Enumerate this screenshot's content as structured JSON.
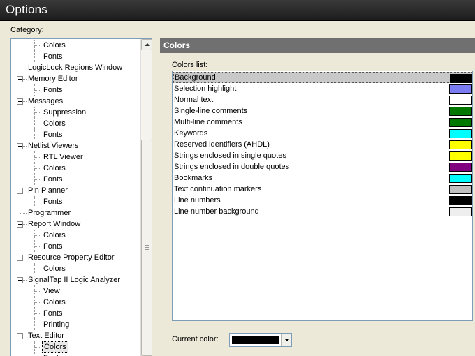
{
  "window": {
    "title": "Options"
  },
  "category": {
    "label": "Category:",
    "tree": [
      {
        "label": "Colors",
        "level": 2
      },
      {
        "label": "Fonts",
        "level": 2
      },
      {
        "label": "LogicLock Regions Window",
        "level": 1,
        "expander": false
      },
      {
        "label": "Memory Editor",
        "level": 1,
        "expander": true
      },
      {
        "label": "Fonts",
        "level": 2
      },
      {
        "label": "Messages",
        "level": 1,
        "expander": true
      },
      {
        "label": "Suppression",
        "level": 2
      },
      {
        "label": "Colors",
        "level": 2
      },
      {
        "label": "Fonts",
        "level": 2
      },
      {
        "label": "Netlist Viewers",
        "level": 1,
        "expander": true
      },
      {
        "label": "RTL Viewer",
        "level": 2
      },
      {
        "label": "Colors",
        "level": 2
      },
      {
        "label": "Fonts",
        "level": 2
      },
      {
        "label": "Pin Planner",
        "level": 1,
        "expander": true
      },
      {
        "label": "Fonts",
        "level": 2
      },
      {
        "label": "Programmer",
        "level": 1,
        "expander": false
      },
      {
        "label": "Report Window",
        "level": 1,
        "expander": true
      },
      {
        "label": "Colors",
        "level": 2
      },
      {
        "label": "Fonts",
        "level": 2
      },
      {
        "label": "Resource Property Editor",
        "level": 1,
        "expander": true
      },
      {
        "label": "Colors",
        "level": 2
      },
      {
        "label": "SignalTap II Logic Analyzer",
        "level": 1,
        "expander": true
      },
      {
        "label": "View",
        "level": 2
      },
      {
        "label": "Colors",
        "level": 2
      },
      {
        "label": "Fonts",
        "level": 2
      },
      {
        "label": "Printing",
        "level": 2
      },
      {
        "label": "Text Editor",
        "level": 1,
        "expander": true
      },
      {
        "label": "Colors",
        "level": 2,
        "selected": true
      },
      {
        "label": "Fonts",
        "level": 2
      }
    ]
  },
  "panel": {
    "title": "Colors",
    "colors_list_label": "Colors list:",
    "colors_list": [
      {
        "name": "Background",
        "color": "#000000",
        "selected": true
      },
      {
        "name": "Selection highlight",
        "color": "#7b7bf2"
      },
      {
        "name": "Normal text",
        "color": "#ffffff"
      },
      {
        "name": "Single-line comments",
        "color": "#007800"
      },
      {
        "name": "Multi-line comments",
        "color": "#007800"
      },
      {
        "name": "Keywords",
        "color": "#00ffff"
      },
      {
        "name": "Reserved identifiers (AHDL)",
        "color": "#ffff00"
      },
      {
        "name": "Strings enclosed in single quotes",
        "color": "#ffff00"
      },
      {
        "name": "Strings enclosed in double quotes",
        "color": "#800080"
      },
      {
        "name": "Bookmarks",
        "color": "#00ffff"
      },
      {
        "name": "Text continuation markers",
        "color": "#c0c0c0"
      },
      {
        "name": "Line numbers",
        "color": "#000000"
      },
      {
        "name": "Line number background",
        "color": "#eeeeee"
      }
    ],
    "current_color_label": "Current color:",
    "current_color": "#000000"
  }
}
